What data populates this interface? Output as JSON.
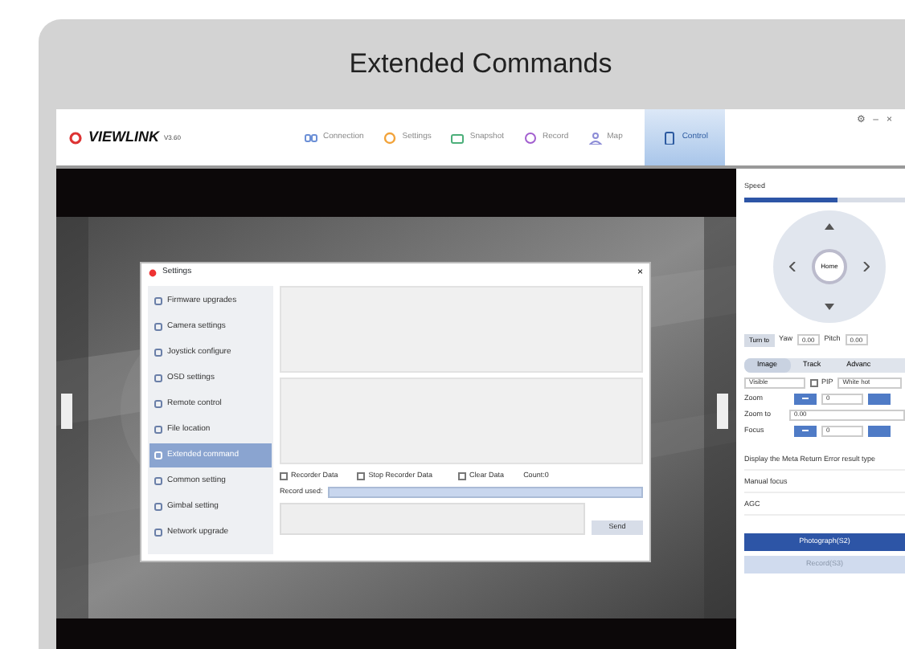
{
  "title": "Extended Commands",
  "app": {
    "logo": "VIEWLINK",
    "version": "V3.60",
    "nav": [
      {
        "label": "Connection",
        "selected": false
      },
      {
        "label": "Settings",
        "selected": false
      },
      {
        "label": "Snapshot",
        "selected": false
      },
      {
        "label": "Record",
        "selected": false
      },
      {
        "label": "Map",
        "selected": false
      },
      {
        "label": "Control",
        "selected": true
      }
    ],
    "window_controls": [
      "⚙",
      "–",
      "×"
    ],
    "dialog": {
      "title": "Settings",
      "close": "×",
      "sidebar": [
        {
          "label": "Firmware upgrades",
          "selected": false
        },
        {
          "label": "Camera settings",
          "selected": false
        },
        {
          "label": "Joystick configure",
          "selected": false
        },
        {
          "label": "OSD settings",
          "selected": false
        },
        {
          "label": "Remote control",
          "selected": false
        },
        {
          "label": "File location",
          "selected": false
        },
        {
          "label": "Extended command",
          "selected": true
        },
        {
          "label": "Common setting",
          "selected": false
        },
        {
          "label": "Gimbal setting",
          "selected": false
        },
        {
          "label": "Network upgrade",
          "selected": false
        }
      ],
      "checkboxes": [
        {
          "label": "Recorder Data",
          "checked": false
        },
        {
          "label": "Stop Recorder Data",
          "checked": false
        },
        {
          "label": "Clear Data",
          "checked": false
        }
      ],
      "count": "Count:0",
      "record_label": "Record used:",
      "send": "Send"
    },
    "panel": {
      "speed_label": "Speed",
      "speed": {
        "level": 0.58
      },
      "home": "Home",
      "turn_to": "Turn to",
      "yaw_label": "Yaw",
      "yaw": "0.00",
      "pitch_label": "Pitch",
      "pitch": "0.00",
      "tabs": [
        {
          "label": "Image",
          "selected": true
        },
        {
          "label": "Track",
          "selected": false
        },
        {
          "label": "Advanc",
          "selected": false
        }
      ],
      "mode": "Visible",
      "pip": {
        "label": "PIP",
        "checked": false
      },
      "palette": "White hot",
      "zoom_label": "Zoom",
      "zoom_value": "0",
      "zoom_to_label": "Zoom to",
      "zoom_to": "0.00",
      "focus_label": "Focus",
      "focus_value": "0",
      "options": [
        "Display the Meta Return Error result type",
        "Manual focus",
        "AGC"
      ],
      "buttons": [
        {
          "label": "Photograph(S2)",
          "disabled": false
        },
        {
          "label": "Record(S3)",
          "disabled": true
        }
      ]
    }
  }
}
